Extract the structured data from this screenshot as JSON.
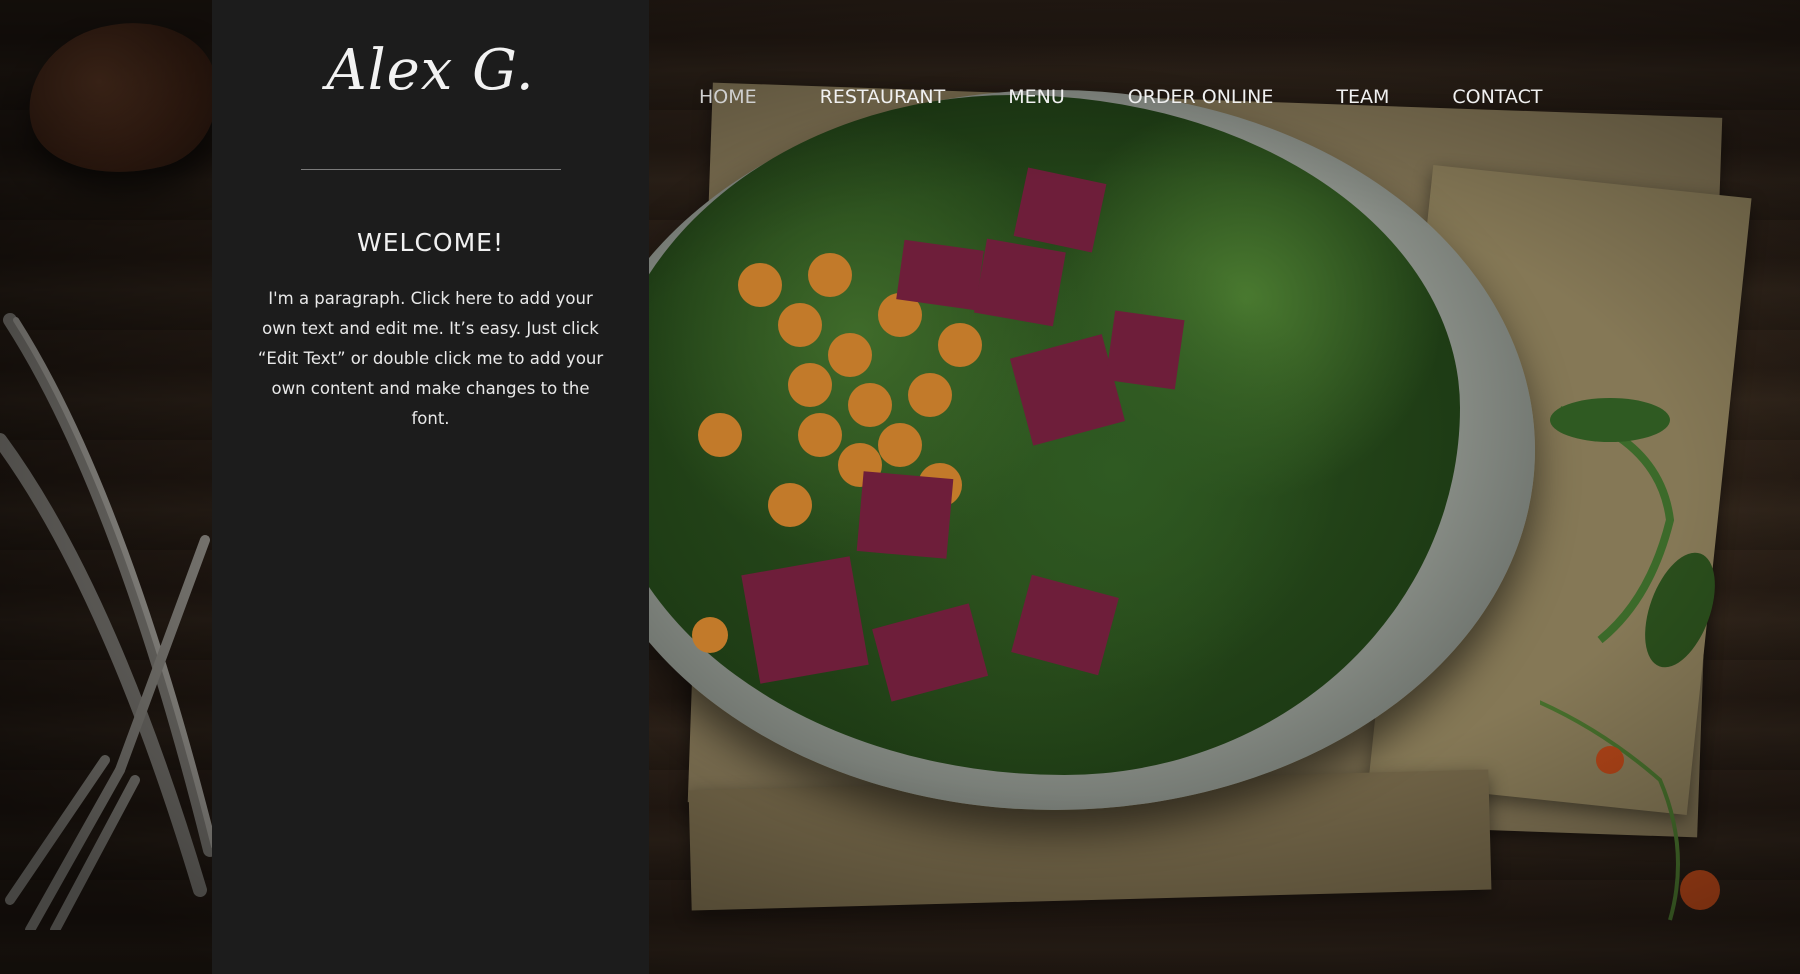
{
  "logo": "Alex G.",
  "nav": {
    "items": [
      "HOME",
      "RESTAURANT",
      "MENU",
      "ORDER ONLINE",
      "TEAM",
      "CONTACT"
    ]
  },
  "welcome": {
    "heading": "WELCOME!",
    "paragraph": "I'm a paragraph. Click here to add your own text and edit me. It’s easy. Just click “Edit Text” or double click me to add your own content and make changes to the font."
  },
  "colors": {
    "sidebar": "#1c1c1c",
    "text": "#f0f0f0"
  }
}
